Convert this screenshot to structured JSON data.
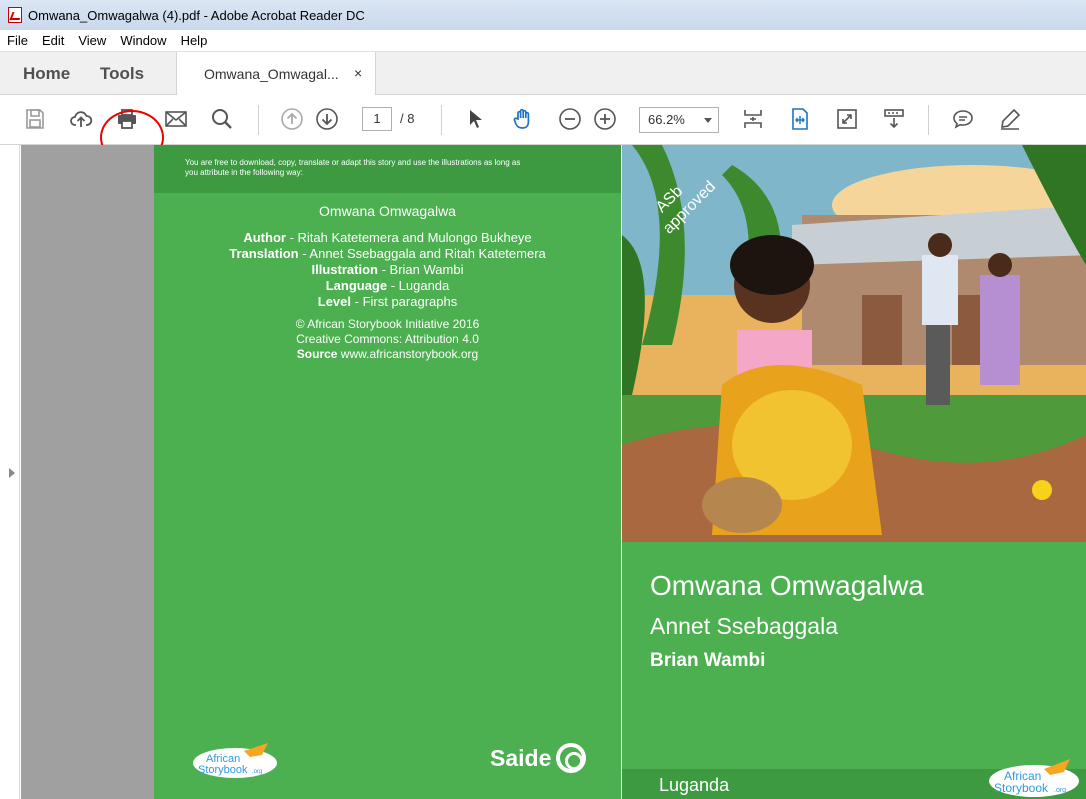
{
  "window": {
    "title": "Omwana_Omwagalwa (4).pdf - Adobe Acrobat Reader DC"
  },
  "menu": {
    "items": [
      "File",
      "Edit",
      "View",
      "Window",
      "Help"
    ]
  },
  "tabs": {
    "home": "Home",
    "tools": "Tools",
    "document": "Omwana_Omwagal...",
    "close": "×"
  },
  "toolbar": {
    "page_current": "1",
    "page_total": "/ 8",
    "zoom": "66.2%"
  },
  "left_page": {
    "license_line1": "You are free to download, copy, translate or adapt this story and use the illustrations as long as",
    "license_line2": "you attribute in the following way:",
    "title": "Omwana Omwagalwa",
    "author_label": "Author",
    "author_value": " - Ritah Katetemera and Mulongo Bukheye",
    "translation_label": "Translation",
    "translation_value": " - Annet Ssebaggala and Ritah Katetemera",
    "illustration_label": "Illustration",
    "illustration_value": " - Brian Wambi",
    "language_label": "Language",
    "language_value": " - Luganda",
    "level_label": "Level",
    "level_value": " - First paragraphs",
    "copyright": "© African Storybook Initiative 2016",
    "license": "Creative Commons: Attribution 4.0",
    "source_label": "Source",
    "source_value": " www.africanstorybook.org",
    "asb_logo_line1": "African",
    "asb_logo_line2": "Storybook",
    "asb_logo_suffix": ".org",
    "saide": "Saide"
  },
  "right_page": {
    "badge_line1": "ASb",
    "badge_line2": "approved",
    "title": "Omwana Omwagalwa",
    "author": "Annet Ssebaggala",
    "illustrator": "Brian Wambi",
    "language": "Luganda",
    "asb_logo_line1": "African",
    "asb_logo_line2": "Storybook",
    "asb_logo_suffix": ".org"
  },
  "colors": {
    "page_green": "#4caf50",
    "band_green": "#3d9a41",
    "highlight": "#e00000"
  }
}
